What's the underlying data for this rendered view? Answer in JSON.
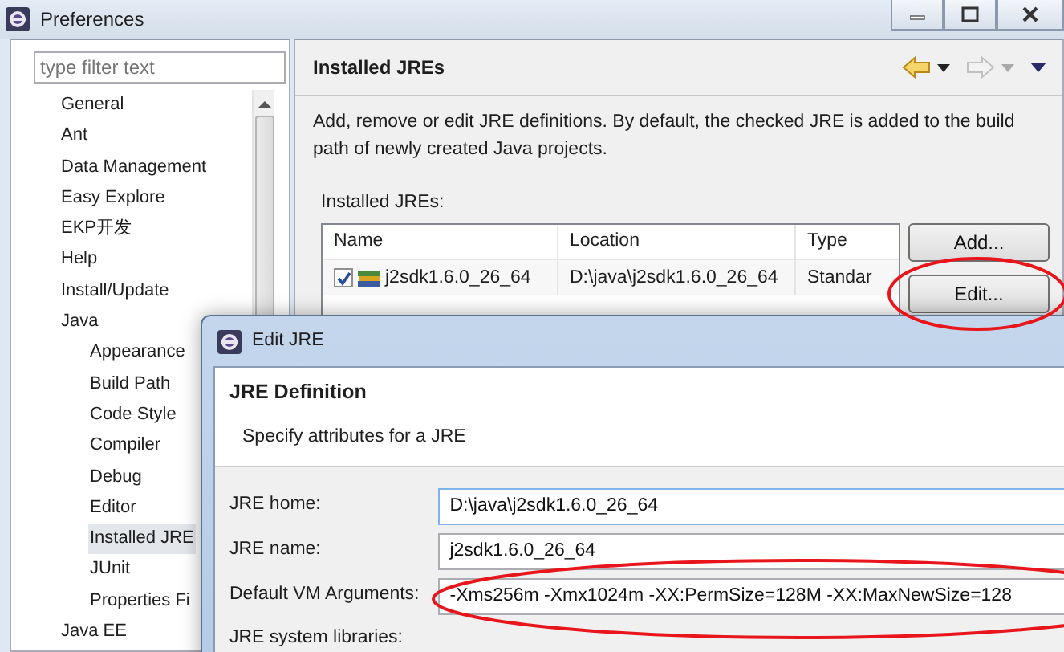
{
  "window": {
    "title": "Preferences"
  },
  "filter": {
    "placeholder": "type filter text"
  },
  "tree": [
    {
      "label": "General",
      "selected": false
    },
    {
      "label": "Ant",
      "selected": false
    },
    {
      "label": "Data Management",
      "selected": false
    },
    {
      "label": "Easy Explore",
      "selected": false
    },
    {
      "label": "EKP开发",
      "selected": false
    },
    {
      "label": "Help",
      "selected": false
    },
    {
      "label": "Install/Update",
      "selected": false
    },
    {
      "label": "Java",
      "selected": false,
      "children": [
        {
          "label": "Appearance",
          "selected": false
        },
        {
          "label": "Build Path",
          "selected": false
        },
        {
          "label": "Code Style",
          "selected": false
        },
        {
          "label": "Compiler",
          "selected": false
        },
        {
          "label": "Debug",
          "selected": false
        },
        {
          "label": "Editor",
          "selected": false
        },
        {
          "label": "Installed JRE",
          "selected": true
        },
        {
          "label": "JUnit",
          "selected": false
        },
        {
          "label": "Properties Fi",
          "selected": false
        }
      ]
    },
    {
      "label": "Java EE",
      "selected": false
    }
  ],
  "page": {
    "title": "Installed JREs",
    "description": "Add, remove or edit JRE definitions. By default, the checked JRE is added to the build path of newly created Java projects.",
    "table_label": "Installed JREs:",
    "table": {
      "columns": [
        "Name",
        "Location",
        "Type"
      ],
      "rows": [
        {
          "checked": true,
          "name": "j2sdk1.6.0_26_64",
          "location": "D:\\java\\j2sdk1.6.0_26_64",
          "type": "Standar"
        }
      ]
    },
    "buttons": [
      "Add...",
      "Edit..."
    ]
  },
  "dialog": {
    "title": "Edit JRE",
    "heading": "JRE Definition",
    "subtitle": "Specify attributes for a JRE",
    "fields": [
      {
        "label": "JRE home:",
        "value": "D:\\java\\j2sdk1.6.0_26_64"
      },
      {
        "label": "JRE name:",
        "value": "j2sdk1.6.0_26_64"
      },
      {
        "label": "Default VM Arguments:",
        "value": "-Xms256m -Xmx1024m -XX:PermSize=128M -XX:MaxNewSize=128"
      }
    ],
    "libraries_label": "JRE system libraries:"
  }
}
